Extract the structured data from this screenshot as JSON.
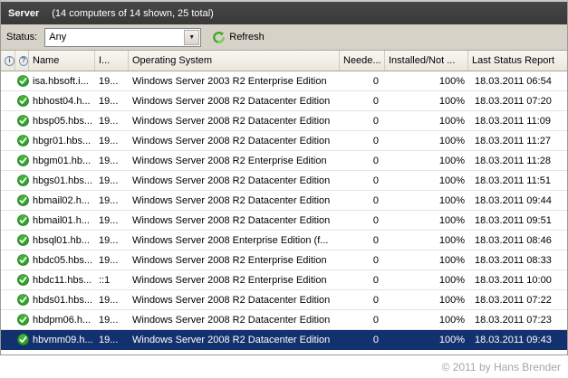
{
  "window": {
    "title": "Server",
    "subtitle": "(14 computers of 14 shown, 25 total)"
  },
  "toolbar": {
    "status_label": "Status:",
    "status_value": "Any",
    "refresh_label": "Refresh"
  },
  "icons": {
    "header_info": "i",
    "header_help": "?",
    "dropdown_arrow": "▼",
    "row_status": "green-check-icon"
  },
  "table": {
    "columns": [
      {
        "icon": "info-icon",
        "label": ""
      },
      {
        "icon": "help-icon",
        "label": ""
      },
      {
        "label": "Name"
      },
      {
        "label": "I..."
      },
      {
        "label": "Operating System"
      },
      {
        "label": "Neede..."
      },
      {
        "label": "Installed/Not ..."
      },
      {
        "label": "Last Status Report"
      }
    ],
    "rows": [
      {
        "name": "isa.hbsoft.i...",
        "ip": "19...",
        "os": "Windows Server 2003 R2 Enterprise Edition",
        "needed": "0",
        "installed": "100%",
        "last_report": "18.03.2011 06:54",
        "selected": false
      },
      {
        "name": "hbhost04.h...",
        "ip": "19...",
        "os": "Windows Server 2008 R2 Datacenter Edition",
        "needed": "0",
        "installed": "100%",
        "last_report": "18.03.2011 07:20",
        "selected": false
      },
      {
        "name": "hbsp05.hbs...",
        "ip": "19...",
        "os": "Windows Server 2008 R2 Datacenter Edition",
        "needed": "0",
        "installed": "100%",
        "last_report": "18.03.2011 11:09",
        "selected": false
      },
      {
        "name": "hbgr01.hbs...",
        "ip": "19...",
        "os": "Windows Server 2008 R2 Datacenter Edition",
        "needed": "0",
        "installed": "100%",
        "last_report": "18.03.2011 11:27",
        "selected": false
      },
      {
        "name": "hbgm01.hb...",
        "ip": "19...",
        "os": "Windows Server 2008 R2 Enterprise Edition",
        "needed": "0",
        "installed": "100%",
        "last_report": "18.03.2011 11:28",
        "selected": false
      },
      {
        "name": "hbgs01.hbs...",
        "ip": "19...",
        "os": "Windows Server 2008 R2 Datacenter Edition",
        "needed": "0",
        "installed": "100%",
        "last_report": "18.03.2011 11:51",
        "selected": false
      },
      {
        "name": "hbmail02.h...",
        "ip": "19...",
        "os": "Windows Server 2008 R2 Datacenter Edition",
        "needed": "0",
        "installed": "100%",
        "last_report": "18.03.2011 09:44",
        "selected": false
      },
      {
        "name": "hbmail01.h...",
        "ip": "19...",
        "os": "Windows Server 2008 R2 Datacenter Edition",
        "needed": "0",
        "installed": "100%",
        "last_report": "18.03.2011 09:51",
        "selected": false
      },
      {
        "name": "hbsql01.hb...",
        "ip": "19...",
        "os": "Windows Server 2008 Enterprise Edition (f...",
        "needed": "0",
        "installed": "100%",
        "last_report": "18.03.2011 08:46",
        "selected": false
      },
      {
        "name": "hbdc05.hbs...",
        "ip": "19...",
        "os": "Windows Server 2008 R2 Enterprise Edition",
        "needed": "0",
        "installed": "100%",
        "last_report": "18.03.2011 08:33",
        "selected": false
      },
      {
        "name": "hbdc11.hbs...",
        "ip": "::1",
        "os": "Windows Server 2008 R2 Enterprise Edition",
        "needed": "0",
        "installed": "100%",
        "last_report": "18.03.2011 10:00",
        "selected": false
      },
      {
        "name": "hbds01.hbs...",
        "ip": "19...",
        "os": "Windows Server 2008 R2 Datacenter Edition",
        "needed": "0",
        "installed": "100%",
        "last_report": "18.03.2011 07:22",
        "selected": false
      },
      {
        "name": "hbdpm06.h...",
        "ip": "19...",
        "os": "Windows Server 2008 R2 Datacenter Edition",
        "needed": "0",
        "installed": "100%",
        "last_report": "18.03.2011 07:23",
        "selected": false
      },
      {
        "name": "hbvmm09.h...",
        "ip": "19...",
        "os": "Windows Server 2008 R2 Datacenter Edition",
        "needed": "0",
        "installed": "100%",
        "last_report": "18.03.2011 09:43",
        "selected": true
      }
    ]
  },
  "footer": {
    "copyright": "© 2011 by Hans Brender"
  },
  "colors": {
    "titlebar_bg": "#3f3f3f",
    "toolbar_bg": "#d6d2c8",
    "selected_row_bg": "#14316f",
    "check_green": "#2fa12b",
    "refresh_green": "#3aa621",
    "footer_text": "#a6a6a6"
  }
}
